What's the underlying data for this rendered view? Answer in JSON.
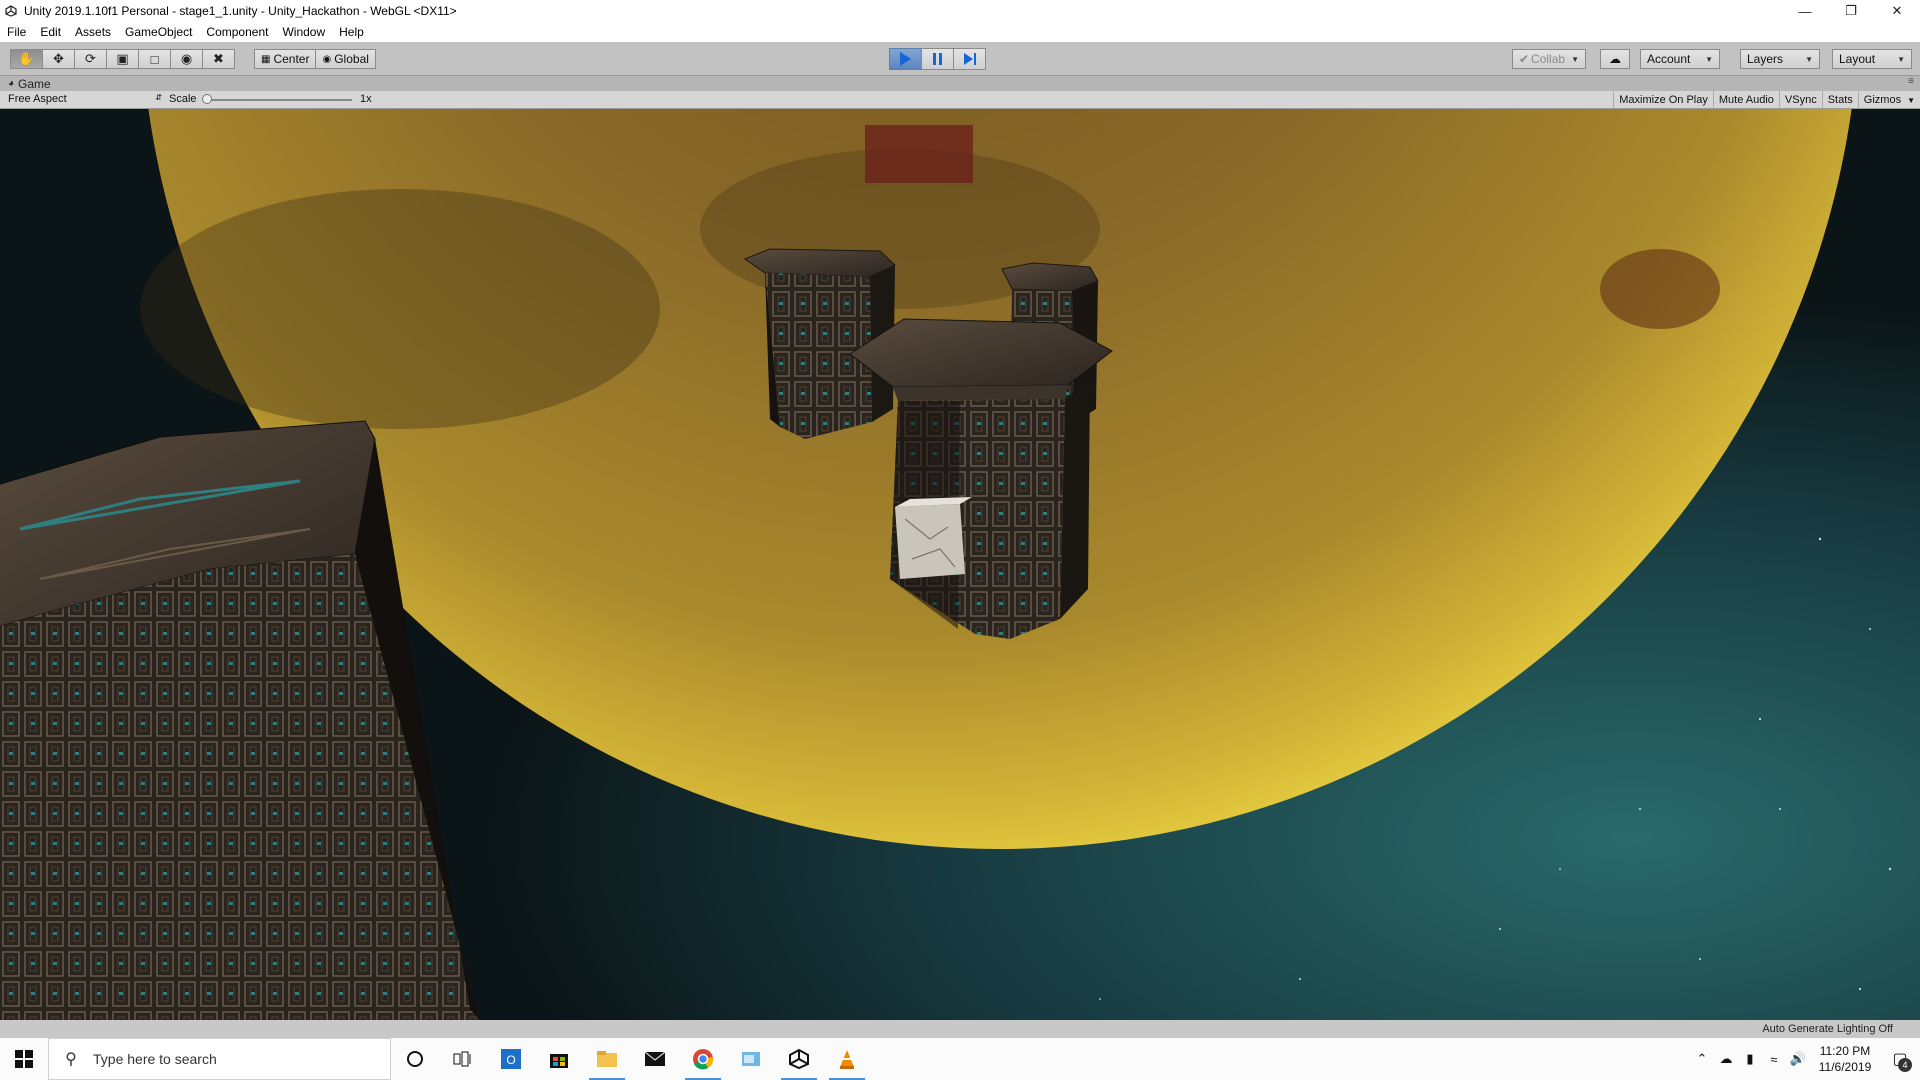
{
  "window": {
    "title": "Unity 2019.1.10f1 Personal - stage1_1.unity - Unity_Hackathon - WebGL <DX11>",
    "minimize_icon": "minimize-icon",
    "restore_icon": "restore-icon",
    "close_icon": "close-icon"
  },
  "menu": {
    "items": [
      "File",
      "Edit",
      "Assets",
      "GameObject",
      "Component",
      "Window",
      "Help"
    ]
  },
  "toolbar": {
    "tools": [
      "hand-tool-icon",
      "move-tool-icon",
      "rotate-tool-icon",
      "scale-tool-icon",
      "rect-tool-icon",
      "transform-tool-icon",
      "custom-tool-icon"
    ],
    "pivot_label": "Center",
    "space_label": "Global",
    "collab_label": "Collab",
    "account_label": "Account",
    "layers_label": "Layers",
    "layout_label": "Layout",
    "play_state": "playing"
  },
  "game_tab": {
    "label": "Game"
  },
  "game_bar": {
    "aspect": "Free Aspect",
    "scale_label": "Scale",
    "scale_value": "1x",
    "toggles": [
      "Maximize On Play",
      "Mute Audio",
      "VSync",
      "Stats",
      "Gizmos"
    ]
  },
  "status": {
    "lighting": "Auto Generate Lighting Off"
  },
  "taskbar": {
    "search_placeholder": "Type here to search",
    "time": "11:20 PM",
    "date": "11/6/2019",
    "notifications": "4",
    "apps": [
      "cortana-icon",
      "task-view-icon",
      "outlook-icon",
      "store-icon",
      "file-explorer-icon",
      "mail-icon",
      "chrome-icon",
      "app-icon",
      "unity-icon",
      "vlc-icon"
    ]
  },
  "colors": {
    "accent_blue": "#1565d8",
    "toolbar_bg": "#c2c2c2",
    "planet_gold": "#c79a2a",
    "space_teal": "#1f5b5c"
  }
}
